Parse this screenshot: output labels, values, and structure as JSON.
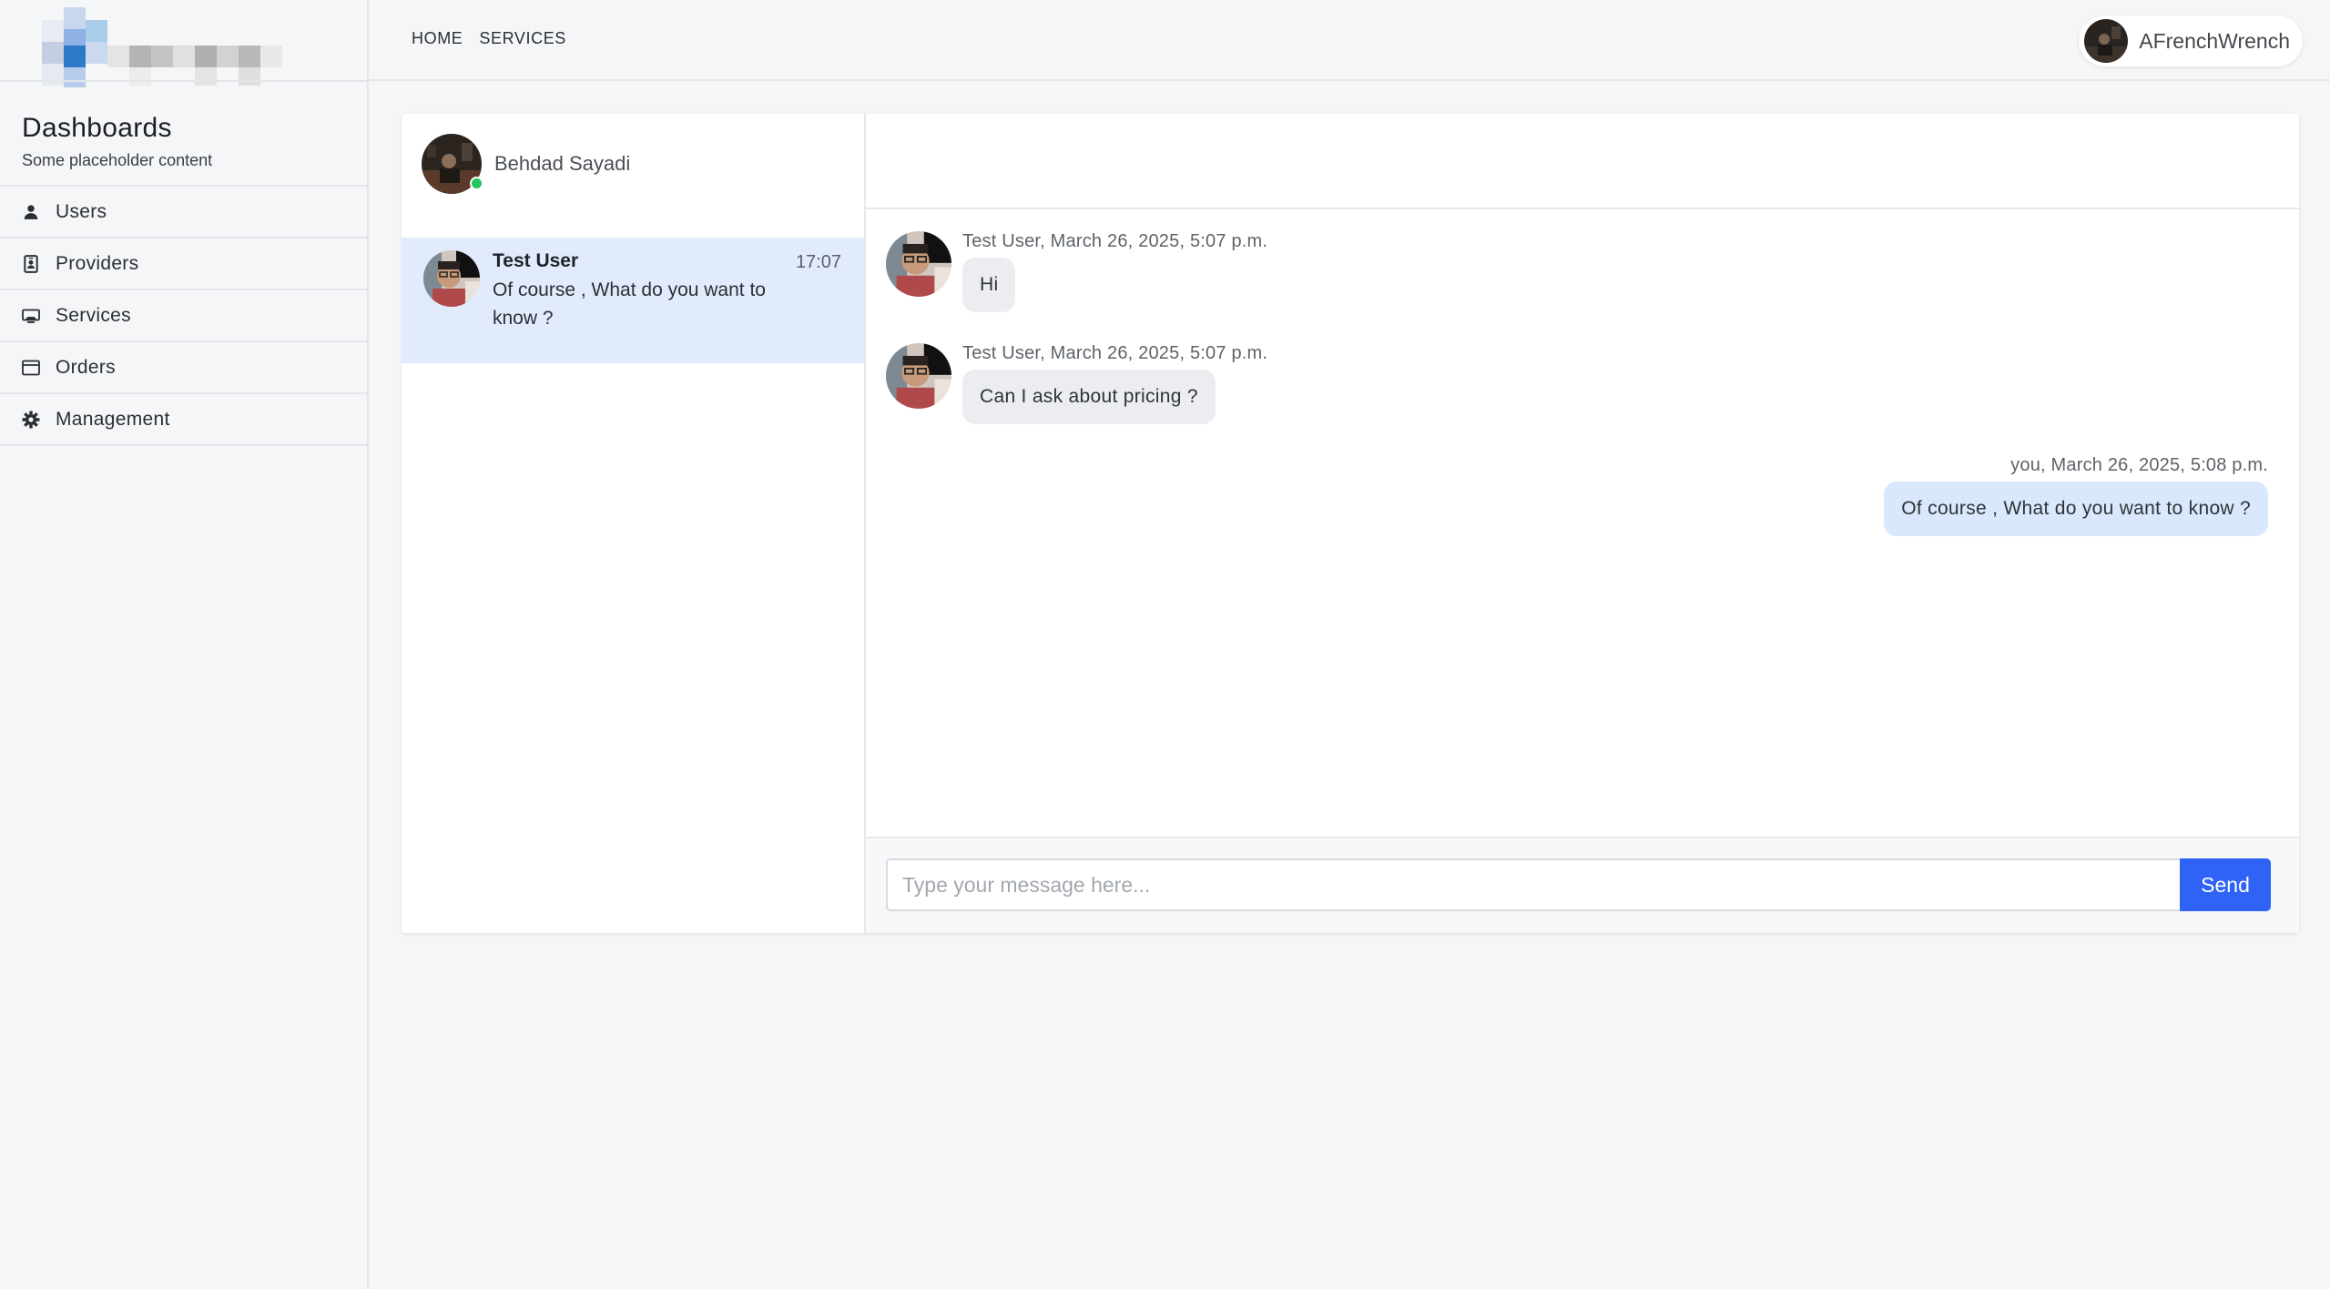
{
  "sidebar": {
    "title": "Dashboards",
    "subtitle": "Some placeholder content",
    "items": [
      {
        "label": "Users",
        "icon": "person-icon"
      },
      {
        "label": "Providers",
        "icon": "id-badge-icon"
      },
      {
        "label": "Services",
        "icon": "tv-icon"
      },
      {
        "label": "Orders",
        "icon": "window-icon"
      },
      {
        "label": "Management",
        "icon": "gear-icon"
      }
    ]
  },
  "header": {
    "nav": [
      "HOME",
      "SERVICES"
    ],
    "username": "AFrenchWrench"
  },
  "chat": {
    "me": {
      "name": "Behdad Sayadi",
      "status": "online"
    },
    "conversations": [
      {
        "name": "Test User",
        "time": "17:07",
        "last_message": "Of course , What do you want to know ?",
        "active": true
      }
    ],
    "messages": [
      {
        "direction": "in",
        "meta": "Test User, March 26, 2025, 5:07 p.m.",
        "text": "Hi"
      },
      {
        "direction": "in",
        "meta": "Test User, March 26, 2025, 5:07 p.m.",
        "text": "Can I ask about pricing ?"
      },
      {
        "direction": "out",
        "meta": "you, March 26, 2025, 5:08 p.m.",
        "text": "Of course , What do you want to know ?"
      }
    ],
    "composer": {
      "placeholder": "Type your message here...",
      "send_label": "Send"
    }
  },
  "colors": {
    "accent": "#2f63f6",
    "active_conversation": "#e1ebfb",
    "outgoing_bubble": "#d9e8fd",
    "incoming_bubble": "#ebedf0",
    "online": "#21c55d"
  }
}
